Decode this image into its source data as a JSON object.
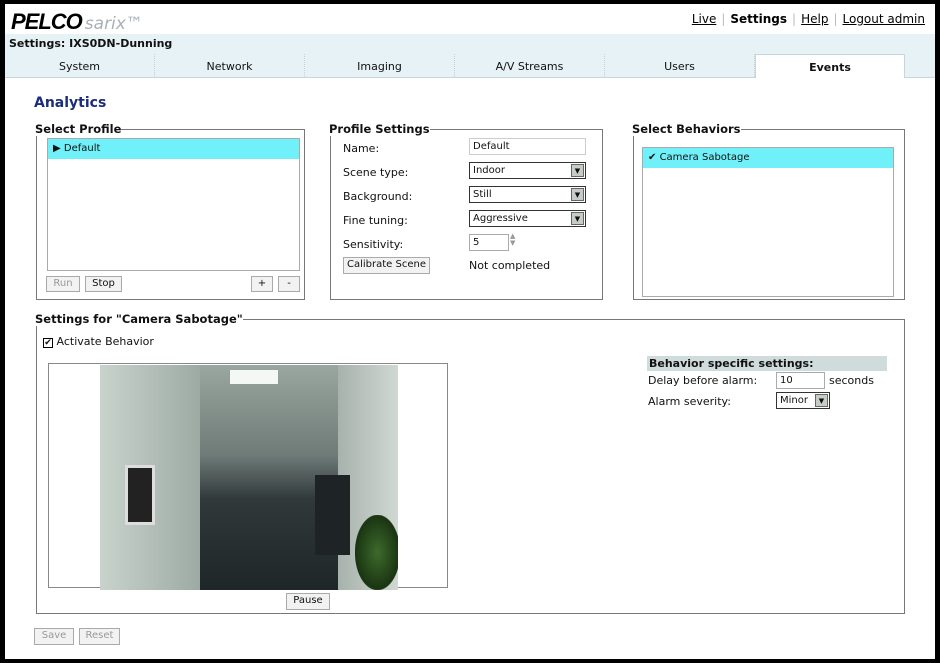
{
  "brand": {
    "logo": "PELCO",
    "product": "sarix™"
  },
  "top_links": {
    "live": "Live",
    "settings": "Settings",
    "help": "Help",
    "logout": "Logout admin"
  },
  "device_title": "Settings: IXS0DN-Dunning",
  "tabs": [
    "System",
    "Network",
    "Imaging",
    "A/V Streams",
    "Users",
    "Events"
  ],
  "active_tab": "Events",
  "page_title": "Analytics",
  "select_profile": {
    "legend": "Select Profile",
    "items": [
      "Default"
    ],
    "run": "Run",
    "stop": "Stop",
    "add": "+",
    "remove": "-"
  },
  "profile_settings": {
    "legend": "Profile Settings",
    "name_label": "Name:",
    "name_value": "Default",
    "scene_label": "Scene type:",
    "scene_value": "Indoor",
    "background_label": "Background:",
    "background_value": "Still",
    "fine_label": "Fine tuning:",
    "fine_value": "Aggressive",
    "sensitivity_label": "Sensitivity:",
    "sensitivity_value": "5",
    "calibrate": "Calibrate Scene",
    "calibrate_status": "Not completed"
  },
  "select_behaviors": {
    "legend": "Select Behaviors",
    "items": [
      "Camera Sabotage"
    ]
  },
  "behavior_settings": {
    "legend": "Settings for \"Camera Sabotage\"",
    "activate_label": "Activate Behavior",
    "activate_checked": true,
    "pause": "Pause",
    "specific_header": "Behavior specific settings:",
    "delay_label": "Delay before alarm:",
    "delay_value": "10",
    "delay_unit": "seconds",
    "severity_label": "Alarm severity:",
    "severity_value": "Minor"
  },
  "footer": {
    "save": "Save",
    "reset": "Reset"
  }
}
